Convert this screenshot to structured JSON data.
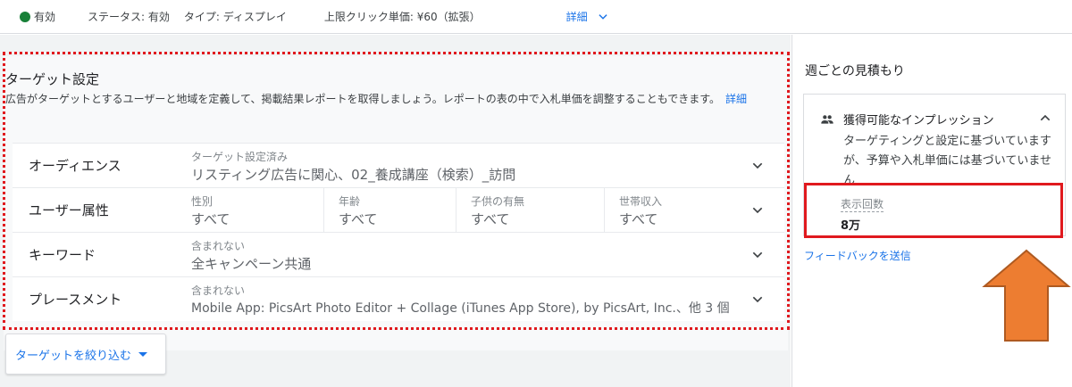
{
  "topbar": {
    "status_dot_label": "有効",
    "status": "ステータス: 有効",
    "type": "タイプ: ディスプレイ",
    "cpc": "上限クリック単価: ¥60（拡張）",
    "details_link": "詳細"
  },
  "targeting": {
    "title": "ターゲット設定",
    "description": "広告がターゲットとするユーザーと地域を定義して、掲載結果レポートを取得しましょう。レポートの表の中で入札単価を調整することもできます。",
    "details_link": "詳細",
    "audience": {
      "label": "オーディエンス",
      "sub": "ターゲット設定済み",
      "value": "リスティング広告に関心、02_養成講座（検索）_訪問"
    },
    "demographics": {
      "label": "ユーザー属性",
      "columns": [
        {
          "sub": "性別",
          "value": "すべて"
        },
        {
          "sub": "年齢",
          "value": "すべて"
        },
        {
          "sub": "子供の有無",
          "value": "すべて"
        },
        {
          "sub": "世帯収入",
          "value": "すべて"
        }
      ]
    },
    "keywords": {
      "label": "キーワード",
      "sub": "含まれない",
      "value": "全キャンペーン共通"
    },
    "placements": {
      "label": "プレースメント",
      "sub": "含まれない",
      "value": "Mobile App: PicsArt Photo Editor + Collage (iTunes App Store), by PicsArt, Inc.、他 3 個"
    },
    "narrow_button": "ターゲットを絞り込む"
  },
  "estimates": {
    "title": "週ごとの見積もり",
    "card_title": "獲得可能なインプレッション",
    "card_desc": "ターゲティングと設定に基づいていますが、予算や入札単価には基づいていません",
    "impressions_label": "表示回数",
    "impressions_value": "8万",
    "feedback_link": "フィードバックを送信"
  },
  "colors": {
    "accent": "#1a73e8",
    "status_green": "#188038",
    "highlight_red": "#e0191e",
    "arrow_orange": "#ed7d31"
  }
}
